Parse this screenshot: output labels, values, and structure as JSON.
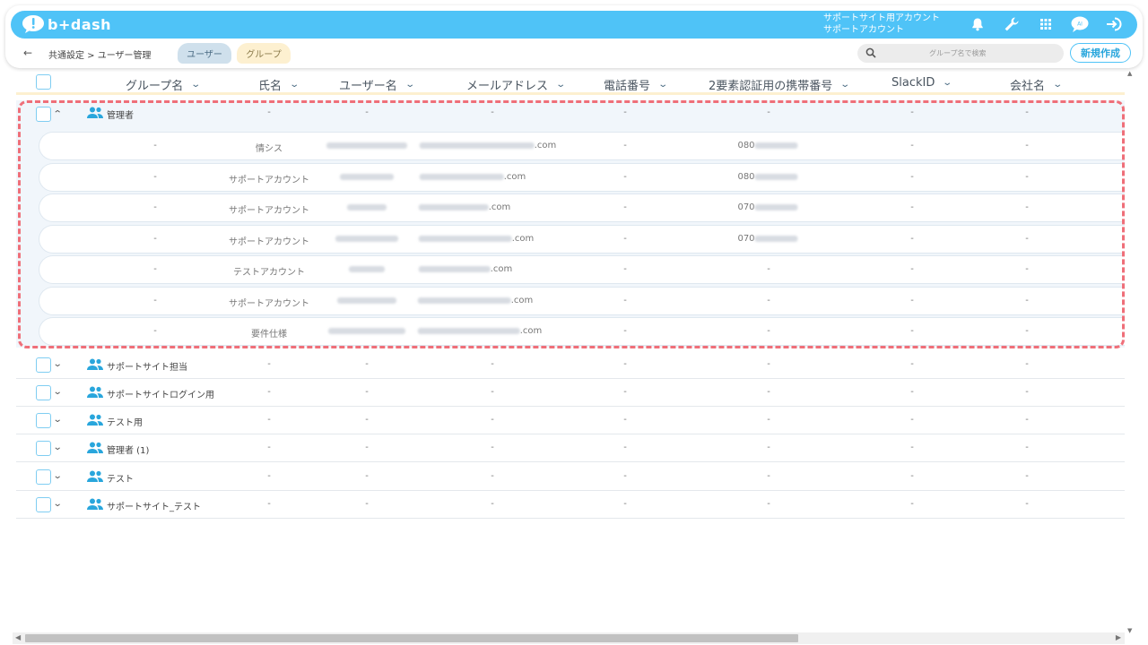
{
  "header": {
    "logo_text": "b+dash",
    "account_line1": "サポートサイト用アカウント",
    "account_line2": "サポートアカウント",
    "icons": [
      "bell-icon",
      "wrench-icon",
      "grid-icon",
      "chat-icon",
      "logout-icon"
    ],
    "accent_color": "#4fc3f7"
  },
  "subbar": {
    "breadcrumb": "共通設定 > ユーザー管理",
    "tabs": [
      {
        "label": "ユーザー"
      },
      {
        "label": "グループ"
      }
    ],
    "search_placeholder": "グループ名で検索",
    "new_button": "新規作成"
  },
  "table": {
    "columns": [
      "グループ名",
      "氏名",
      "ユーザー名",
      "メールアドレス",
      "電話番号",
      "2要素認証用の携帯番号",
      "SlackID",
      "会社名"
    ],
    "expanded_group": {
      "name": "管理者",
      "cells": [
        "-",
        "-",
        "-",
        "-",
        "-",
        "-",
        "-"
      ],
      "users": [
        {
          "group": "-",
          "name": "情シス",
          "email_suffix": ".com",
          "phone": "-",
          "mobile": "080",
          "slack": "-",
          "company": "-"
        },
        {
          "group": "-",
          "name": "サポートアカウント",
          "email_suffix": ".com",
          "phone": "-",
          "mobile": "080",
          "slack": "-",
          "company": "-"
        },
        {
          "group": "-",
          "name": "サポートアカウント",
          "email_suffix": ".com",
          "phone": "-",
          "mobile": "070",
          "slack": "-",
          "company": "-"
        },
        {
          "group": "-",
          "name": "サポートアカウント",
          "email_suffix": ".com",
          "phone": "-",
          "mobile": "070",
          "slack": "-",
          "company": "-"
        },
        {
          "group": "-",
          "name": "テストアカウント",
          "email_suffix": ".com",
          "phone": "-",
          "mobile": "-",
          "slack": "-",
          "company": "-"
        },
        {
          "group": "-",
          "name": "サポートアカウント",
          "email_suffix": ".com",
          "phone": "-",
          "mobile": "-",
          "slack": "-",
          "company": "-"
        },
        {
          "group": "-",
          "name": "要件仕様",
          "email_suffix": ".com",
          "phone": "-",
          "mobile": "-",
          "slack": "-",
          "company": "-"
        }
      ]
    },
    "groups": [
      {
        "name": "サポートサイト担当"
      },
      {
        "name": "サポートサイトログイン用"
      },
      {
        "name": "テスト用"
      },
      {
        "name": "管理者 (1)"
      },
      {
        "name": "テスト"
      },
      {
        "name": "サポートサイト_テスト"
      }
    ],
    "empty_cell": "-"
  }
}
